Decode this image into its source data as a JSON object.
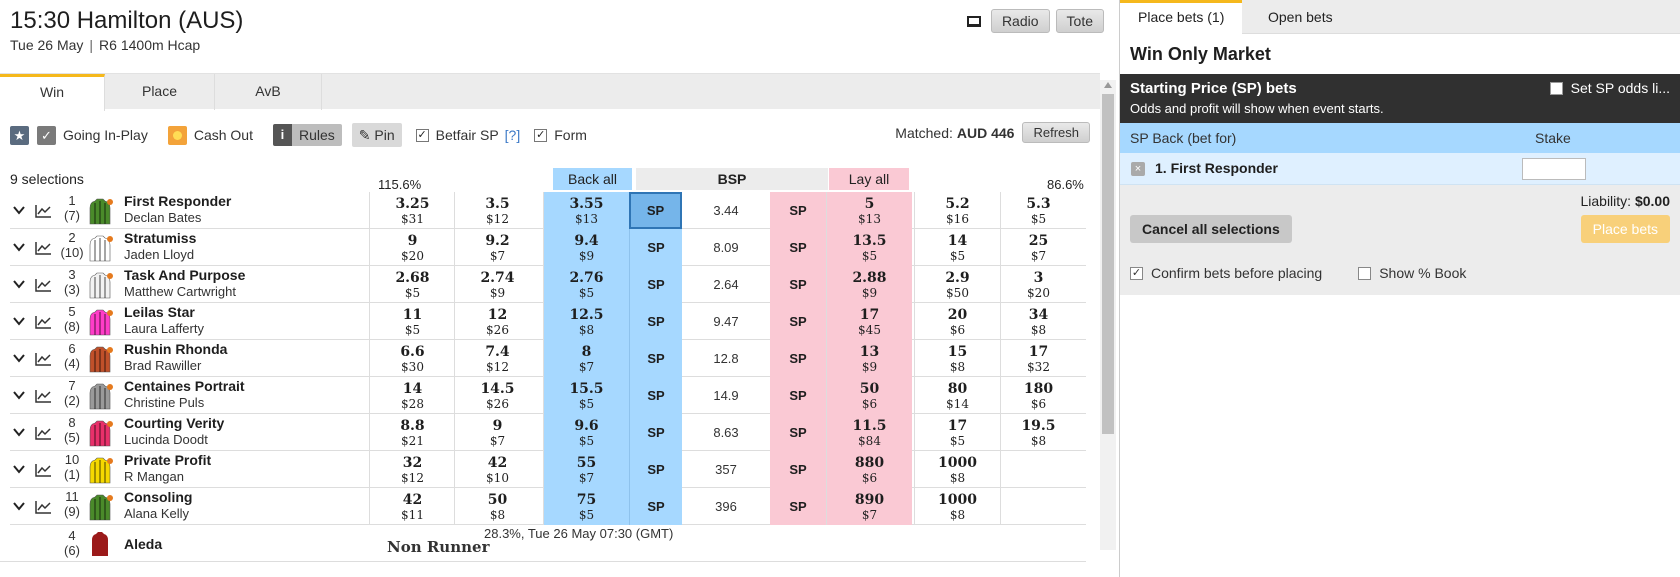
{
  "event": {
    "title": "15:30 Hamilton (AUS)",
    "date": "Tue 26 May",
    "separator": "|",
    "race": "R6 1400m Hcap"
  },
  "top_buttons": {
    "radio": "Radio",
    "tote": "Tote"
  },
  "tabs": [
    "Win",
    "Place",
    "AvB"
  ],
  "toolbar": {
    "going_in_play": "Going In-Play",
    "cash_out": "Cash Out",
    "info": "i",
    "rules": "Rules",
    "pin": "Pin",
    "betfair_sp": "Betfair SP",
    "help": "[?]",
    "form": "Form",
    "matched_label": "Matched:",
    "matched_value": "AUD 446",
    "refresh": "Refresh"
  },
  "market_header": {
    "selections": "9 selections",
    "back_overround": "115.6%",
    "back_all": "Back all",
    "bsp": "BSP",
    "lay_all": "Lay all",
    "lay_overround": "86.6%"
  },
  "runners": [
    {
      "num": "1",
      "draw": "(7)",
      "name": "First Responder",
      "jockey": "Declan Bates",
      "silk": "#4a8a2a",
      "back": [
        [
          "3.25",
          "$31"
        ],
        [
          "3.5",
          "$12"
        ],
        [
          "3.55",
          "$13"
        ]
      ],
      "bsp": "3.44",
      "lay": [
        [
          "5",
          "$13"
        ],
        [
          "5.2",
          "$16"
        ],
        [
          "5.3",
          "$5"
        ]
      ],
      "sp_selected": true
    },
    {
      "num": "2",
      "draw": "(10)",
      "name": "Stratumiss",
      "jockey": "Jaden Lloyd",
      "silk": "#ffffff",
      "back": [
        [
          "9",
          "$20"
        ],
        [
          "9.2",
          "$7"
        ],
        [
          "9.4",
          "$9"
        ]
      ],
      "bsp": "8.09",
      "lay": [
        [
          "13.5",
          "$5"
        ],
        [
          "14",
          "$5"
        ],
        [
          "25",
          "$7"
        ]
      ],
      "sp_selected": false
    },
    {
      "num": "3",
      "draw": "(3)",
      "name": "Task And Purpose",
      "jockey": "Matthew Cartwright",
      "silk": "#f2f2f2",
      "back": [
        [
          "2.68",
          "$5"
        ],
        [
          "2.74",
          "$9"
        ],
        [
          "2.76",
          "$5"
        ]
      ],
      "bsp": "2.64",
      "lay": [
        [
          "2.88",
          "$9"
        ],
        [
          "2.9",
          "$50"
        ],
        [
          "3",
          "$20"
        ]
      ],
      "sp_selected": false
    },
    {
      "num": "5",
      "draw": "(8)",
      "name": "Leilas Star",
      "jockey": "Laura Lafferty",
      "silk": "#ff3cc8",
      "back": [
        [
          "11",
          "$5"
        ],
        [
          "12",
          "$26"
        ],
        [
          "12.5",
          "$8"
        ]
      ],
      "bsp": "9.47",
      "lay": [
        [
          "17",
          "$45"
        ],
        [
          "20",
          "$6"
        ],
        [
          "34",
          "$8"
        ]
      ],
      "sp_selected": false
    },
    {
      "num": "6",
      "draw": "(4)",
      "name": "Rushin Rhonda",
      "jockey": "Brad Rawiller",
      "silk": "#c0502a",
      "back": [
        [
          "6.6",
          "$30"
        ],
        [
          "7.4",
          "$12"
        ],
        [
          "8",
          "$7"
        ]
      ],
      "bsp": "12.8",
      "lay": [
        [
          "13",
          "$9"
        ],
        [
          "15",
          "$8"
        ],
        [
          "17",
          "$32"
        ]
      ],
      "sp_selected": false
    },
    {
      "num": "7",
      "draw": "(2)",
      "name": "Centaines Portrait",
      "jockey": "Christine Puls",
      "silk": "#9a9a9a",
      "back": [
        [
          "14",
          "$28"
        ],
        [
          "14.5",
          "$26"
        ],
        [
          "15.5",
          "$5"
        ]
      ],
      "bsp": "14.9",
      "lay": [
        [
          "50",
          "$6"
        ],
        [
          "80",
          "$14"
        ],
        [
          "180",
          "$6"
        ]
      ],
      "sp_selected": false
    },
    {
      "num": "8",
      "draw": "(5)",
      "name": "Courting Verity",
      "jockey": "Lucinda Doodt",
      "silk": "#e8306a",
      "back": [
        [
          "8.8",
          "$21"
        ],
        [
          "9",
          "$7"
        ],
        [
          "9.6",
          "$5"
        ]
      ],
      "bsp": "8.63",
      "lay": [
        [
          "11.5",
          "$84"
        ],
        [
          "17",
          "$5"
        ],
        [
          "19.5",
          "$8"
        ]
      ],
      "sp_selected": false
    },
    {
      "num": "10",
      "draw": "(1)",
      "name": "Private Profit",
      "jockey": "R Mangan",
      "silk": "#f5d800",
      "back": [
        [
          "32",
          "$12"
        ],
        [
          "42",
          "$10"
        ],
        [
          "55",
          "$7"
        ]
      ],
      "bsp": "357",
      "lay": [
        [
          "880",
          "$6"
        ],
        [
          "1000",
          "$8"
        ],
        [
          "",
          ""
        ]
      ],
      "sp_selected": false
    },
    {
      "num": "11",
      "draw": "(9)",
      "name": "Consoling",
      "jockey": "Alana Kelly",
      "silk": "#4a8a2a",
      "back": [
        [
          "42",
          "$11"
        ],
        [
          "50",
          "$8"
        ],
        [
          "75",
          "$5"
        ]
      ],
      "bsp": "396",
      "lay": [
        [
          "890",
          "$7"
        ],
        [
          "1000",
          "$8"
        ],
        [
          "",
          ""
        ]
      ],
      "sp_selected": false
    }
  ],
  "sp_label": "SP",
  "non_runner": {
    "num": "4",
    "draw": "(6)",
    "name": "Aleda",
    "status": "Non Runner",
    "deduction": "28.3%, Tue 26 May 07:30 (GMT)",
    "silk": "#9b1a1a"
  },
  "betslip": {
    "tabs": [
      "Place bets (1)",
      "Open bets"
    ],
    "market": "Win Only Market",
    "sp_title": "Starting Price (SP) bets",
    "sp_desc": "Odds and profit will show when event starts.",
    "set_sp": "Set SP odds li...",
    "col_back": "SP Back (bet for)",
    "col_stake": "Stake",
    "selection": "1. First Responder",
    "remove": "×",
    "liability_label": "Liability:",
    "liability_value": "$0.00",
    "cancel": "Cancel all selections",
    "place": "Place bets",
    "confirm": "Confirm bets before placing",
    "show_book": "Show % Book"
  }
}
